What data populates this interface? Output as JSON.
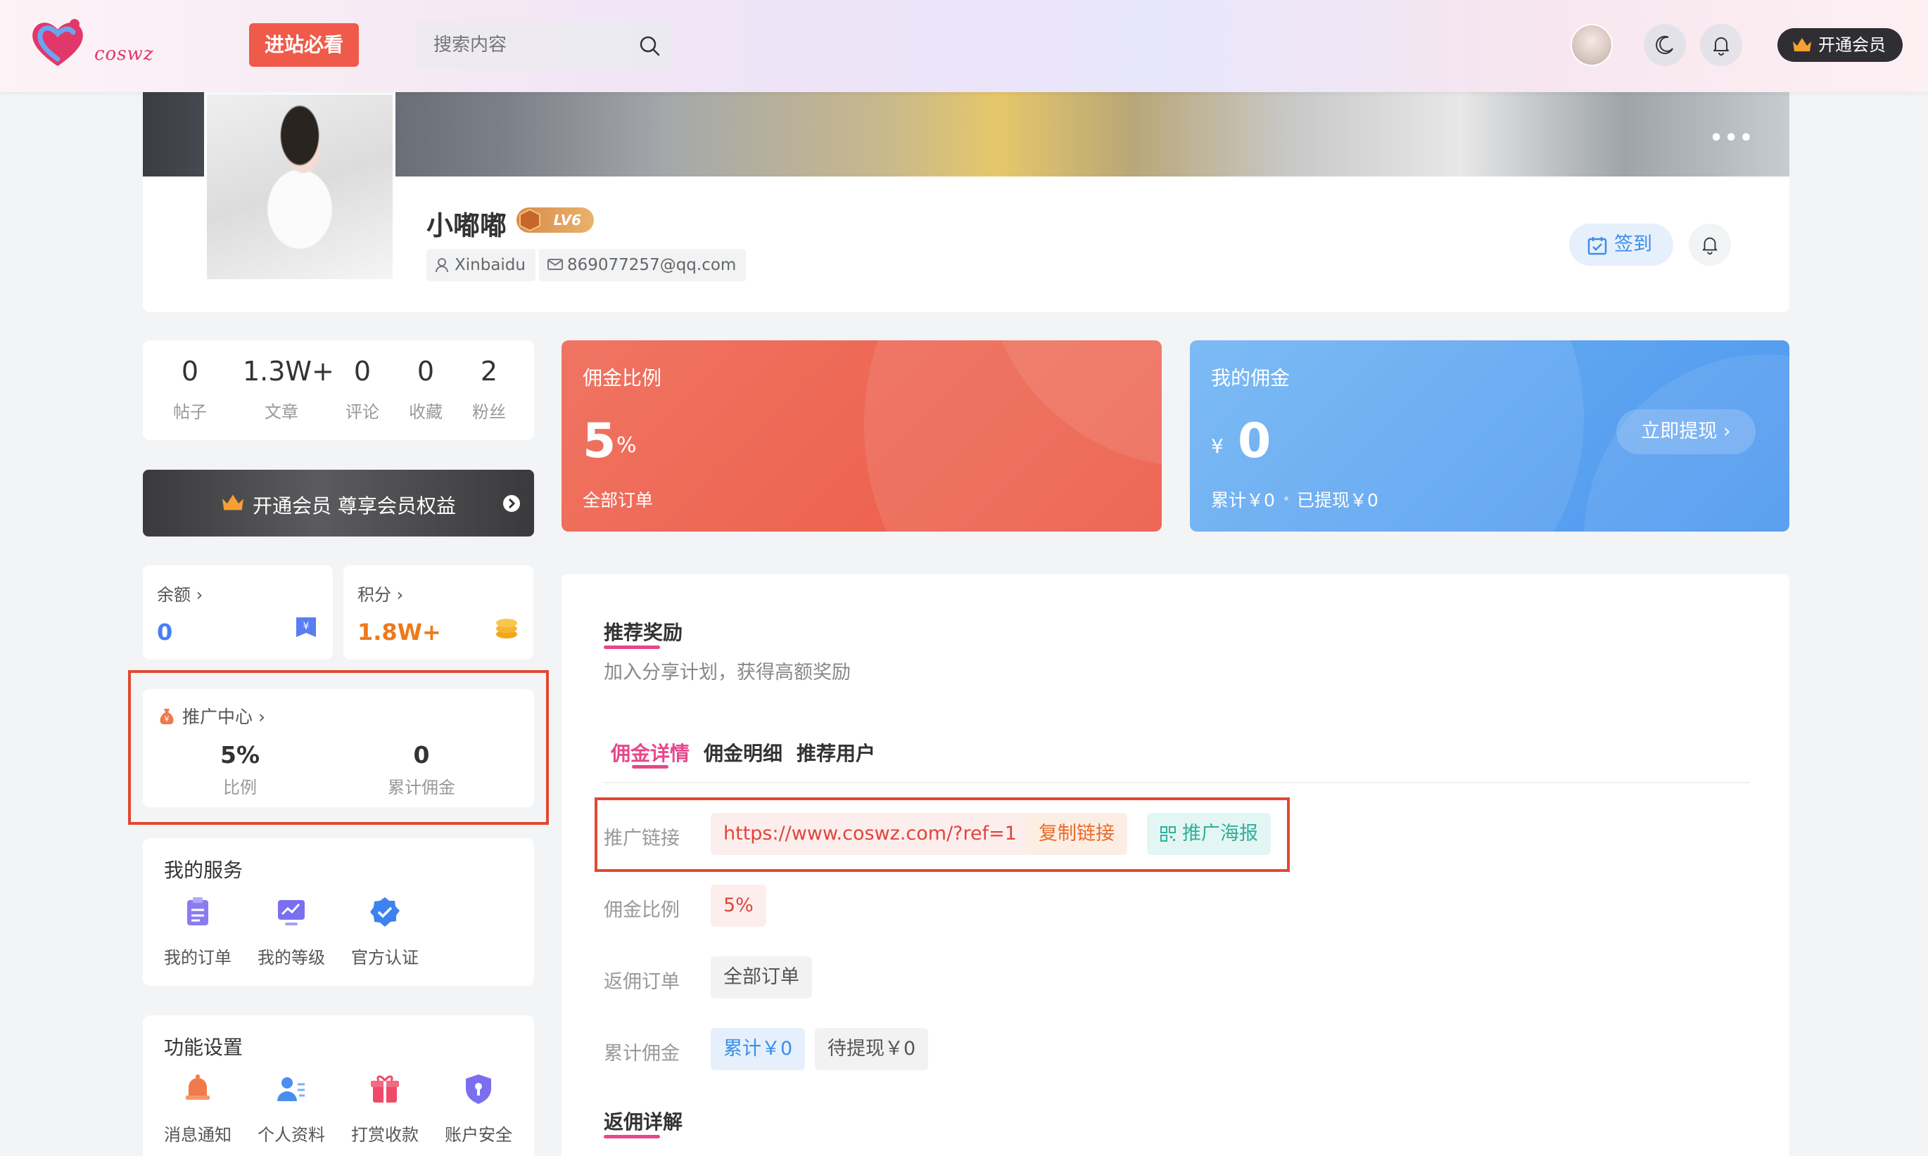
{
  "nav": {
    "logo_text": "coswz",
    "promo_label": "进站必看",
    "search_placeholder": "搜索内容",
    "vip_label": "开通会员"
  },
  "profile": {
    "name": "小嘟嘟",
    "level": "LV6",
    "username": "Xinbaidu",
    "email": "869077257@qq.com",
    "signin_label": "签到",
    "more": "•••"
  },
  "stats": [
    {
      "value": "0",
      "label": "帖子"
    },
    {
      "value": "1.3W+",
      "label": "文章"
    },
    {
      "value": "0",
      "label": "评论"
    },
    {
      "value": "0",
      "label": "收藏"
    },
    {
      "value": "2",
      "label": "粉丝"
    }
  ],
  "vip_banner": "开通会员 尊享会员权益",
  "balance": {
    "label": "余额 ›",
    "value": "0"
  },
  "points": {
    "label": "积分 ›",
    "value": "1.8W+"
  },
  "promo_center": {
    "title": "推广中心 ›",
    "ratio_value": "5%",
    "ratio_label": "比例",
    "total_value": "0",
    "total_label": "累计佣金"
  },
  "services": {
    "title": "我的服务",
    "items": [
      "我的订单",
      "我的等级",
      "官方认证"
    ]
  },
  "settings": {
    "title": "功能设置",
    "items": [
      "消息通知",
      "个人资料",
      "打赏收款",
      "账户安全"
    ]
  },
  "commission_ratio_card": {
    "title": "佣金比例",
    "value": "5",
    "unit": "%",
    "sub": "全部订单"
  },
  "my_commission_card": {
    "title": "我的佣金",
    "currency": "¥",
    "value": "0",
    "total": "累计￥0",
    "withdrawn": "已提现￥0",
    "withdraw_btn": "立即提现 ›"
  },
  "main": {
    "title": "推荐奖励",
    "desc": "加入分享计划，获得高额奖励",
    "tabs": [
      "佣金详情",
      "佣金明细",
      "推荐用户"
    ],
    "rows": {
      "link_label": "推广链接",
      "link_value": "https://www.coswz.com/?ref=1",
      "copy_btn": "复制链接",
      "poster_btn": "推广海报",
      "ratio_label": "佣金比例",
      "ratio_value": "5%",
      "order_label": "返佣订单",
      "order_value": "全部订单",
      "total_label": "累计佣金",
      "total_value": "累计￥0",
      "pending_value": "待提现￥0"
    },
    "section2_title": "返佣详解"
  },
  "colors": {
    "accent_pink": "#e8468c",
    "promo_red": "#ef5a4a",
    "card_red": "#ec5a46",
    "card_blue": "#4d96ef",
    "highlight_outline": "#e04a32"
  }
}
